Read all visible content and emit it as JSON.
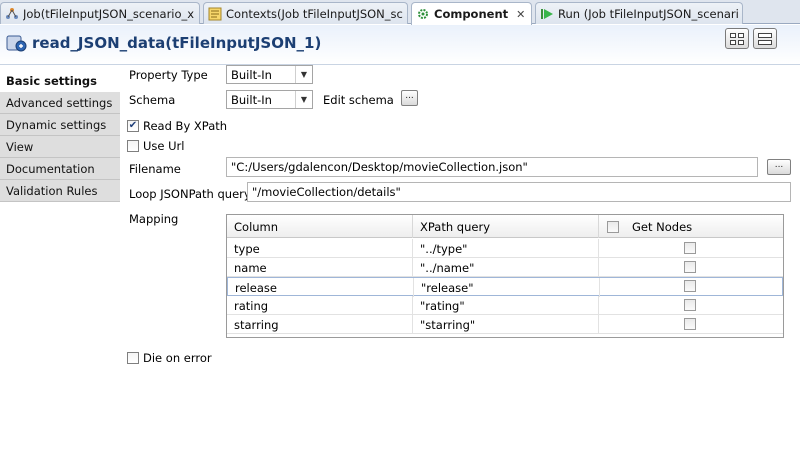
{
  "tabs": [
    {
      "label": "Job(tFileInputJSON_scenario_xpat",
      "icon": "job-icon"
    },
    {
      "label": "Contexts(Job tFileInputJSON_scen",
      "icon": "contexts-icon"
    },
    {
      "label": "Component",
      "icon": "component-icon",
      "active": true
    },
    {
      "label": "Run (Job tFileInputJSON_scenario",
      "icon": "run-icon"
    }
  ],
  "header": {
    "title": "read_JSON_data(tFileInputJSON_1)"
  },
  "nav": {
    "items": [
      {
        "label": "Basic settings",
        "active": true
      },
      {
        "label": "Advanced settings"
      },
      {
        "label": "Dynamic settings"
      },
      {
        "label": "View"
      },
      {
        "label": "Documentation"
      },
      {
        "label": "Validation Rules"
      }
    ]
  },
  "form": {
    "property_type_label": "Property Type",
    "property_type_value": "Built-In",
    "schema_label": "Schema",
    "schema_value": "Built-In",
    "edit_schema_label": "Edit schema",
    "edit_schema_button": "...",
    "read_by_xpath_label": "Read By XPath",
    "read_by_xpath_checked": true,
    "use_url_label": "Use Url",
    "use_url_checked": false,
    "filename_label": "Filename",
    "filename_value": "\"C:/Users/gdalencon/Desktop/movieCollection.json\"",
    "browse_button": "...",
    "loop_label": "Loop JSONPath query",
    "loop_value": "\"/movieCollection/details\"",
    "mapping_label": "Mapping",
    "die_on_error_label": "Die on error",
    "die_on_error_checked": false
  },
  "mapping": {
    "columns": [
      "Column",
      "XPath query",
      "Get Nodes"
    ],
    "rows": [
      {
        "column": "type",
        "xpath": "\"../type\"",
        "get_nodes": false
      },
      {
        "column": "name",
        "xpath": "\"../name\"",
        "get_nodes": false
      },
      {
        "column": "release",
        "xpath": "\"release\"",
        "get_nodes": false
      },
      {
        "column": "rating",
        "xpath": "\"rating\"",
        "get_nodes": false
      },
      {
        "column": "starring",
        "xpath": "\"starring\"",
        "get_nodes": false
      }
    ]
  },
  "colors": {
    "title_blue": "#1c3f73",
    "tab_bar_bg": "#dfe5ee",
    "nav_bg": "#dedede",
    "selection_border": "#9fb6d8"
  }
}
